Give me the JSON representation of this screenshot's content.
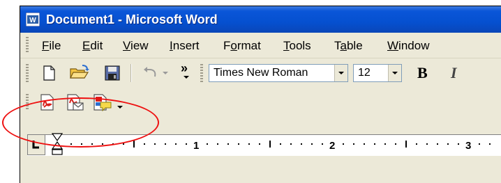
{
  "window": {
    "title": "Document1 - Microsoft Word"
  },
  "menubar": {
    "items": [
      {
        "label": "File",
        "key": "F",
        "rest": "ile"
      },
      {
        "label": "Edit",
        "key": "E",
        "rest": "dit"
      },
      {
        "label": "View",
        "key": "V",
        "rest": "iew"
      },
      {
        "label": "Insert",
        "key": "I",
        "rest": "nsert"
      },
      {
        "label": "Format",
        "pre": "F",
        "key": "o",
        "rest": "rmat"
      },
      {
        "label": "Tools",
        "key": "T",
        "rest": "ools"
      },
      {
        "label": "Table",
        "pre": "T",
        "key": "a",
        "rest": "ble"
      },
      {
        "label": "Window",
        "key": "W",
        "rest": "indow"
      }
    ]
  },
  "formatting": {
    "font_name": "Times New Roman",
    "font_size": "12",
    "bold_label": "B",
    "italic_label": "I",
    "more_buttons": "»"
  },
  "pdf_toolbar": {
    "buttons": [
      "convert-to-pdf",
      "convert-and-email",
      "convert-and-review"
    ]
  },
  "ruler": {
    "labels": [
      "1",
      "2",
      "3"
    ]
  },
  "colors": {
    "annotation": "#e11111",
    "title_bar": "#0550d0",
    "pdf_red": "#d8201c"
  }
}
